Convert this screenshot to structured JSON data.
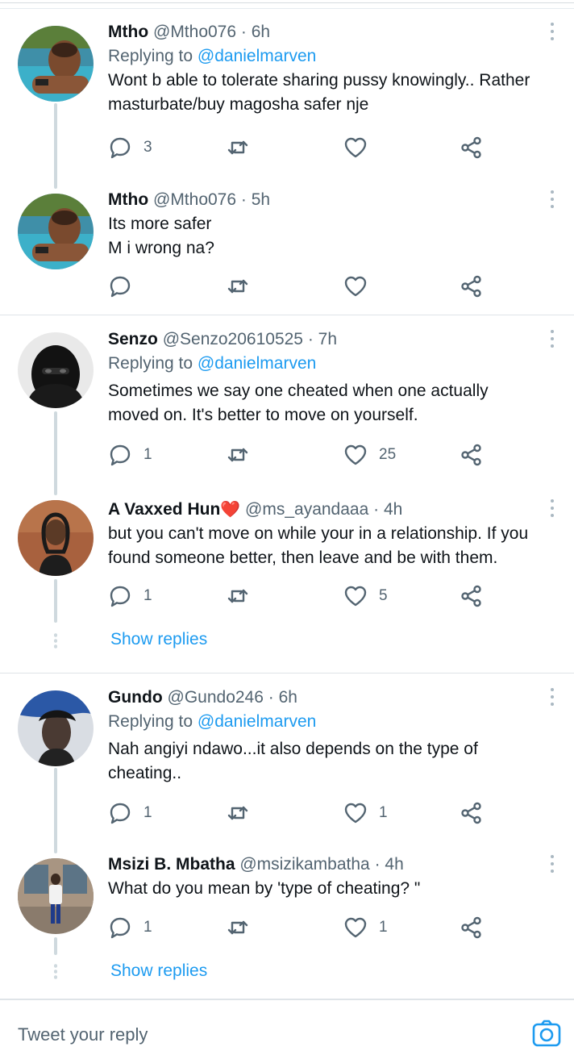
{
  "tweets": [
    {
      "name": "Mtho",
      "handle": "@Mtho076",
      "time": "6h",
      "replying_prefix": "Replying to",
      "replying_to": "@danielmarven",
      "text_lines": [
        "Wont b able to tolerate sharing pussy knowingly.. Rather",
        "masturbate/buy magosha safer nje"
      ],
      "replies": "3",
      "retweets": "",
      "likes": ""
    },
    {
      "name": "Mtho",
      "handle": "@Mtho076",
      "time": "5h",
      "text_lines": [
        "Its more safer",
        "M i wrong na?"
      ],
      "replies": "",
      "retweets": "",
      "likes": ""
    },
    {
      "name": "Senzo",
      "handle": "@Senzo20610525",
      "time": "7h",
      "replying_prefix": "Replying to",
      "replying_to": "@danielmarven",
      "text_lines": [
        "Sometimes we say one cheated when one actually",
        "moved on. It's better to move on yourself."
      ],
      "replies": "1",
      "retweets": "",
      "likes": "25"
    },
    {
      "name": "A Vaxxed Hun",
      "name_emoji": "❤️",
      "handle": "@ms_ayandaaa",
      "time": "4h",
      "text_lines": [
        "but you can't move on while your in a relationship. If you",
        "found someone better, then leave and be with them."
      ],
      "replies": "1",
      "retweets": "",
      "likes": "5",
      "show_replies": "Show replies"
    },
    {
      "name": "Gundo",
      "handle": "@Gundo246",
      "time": "6h",
      "replying_prefix": "Replying to",
      "replying_to": "@danielmarven",
      "text_lines": [
        "Nah angiyi ndawo...it also depends on the type of",
        "cheating.."
      ],
      "replies": "1",
      "retweets": "",
      "likes": "1"
    },
    {
      "name": "Msizi B. Mbatha",
      "handle": "@msizikambatha",
      "time": "4h",
      "text_lines": [
        "What do you mean by 'type of cheating? \""
      ],
      "replies": "1",
      "retweets": "",
      "likes": "1",
      "show_replies": "Show replies"
    }
  ],
  "separator": "·",
  "reply_bar": {
    "placeholder": "Tweet your reply",
    "icon": "camera-icon"
  },
  "colors": {
    "link": "#1d9bf0",
    "muted": "#536471",
    "thread_line": "#cfd9de",
    "heart_emoji": "#d3192b"
  }
}
